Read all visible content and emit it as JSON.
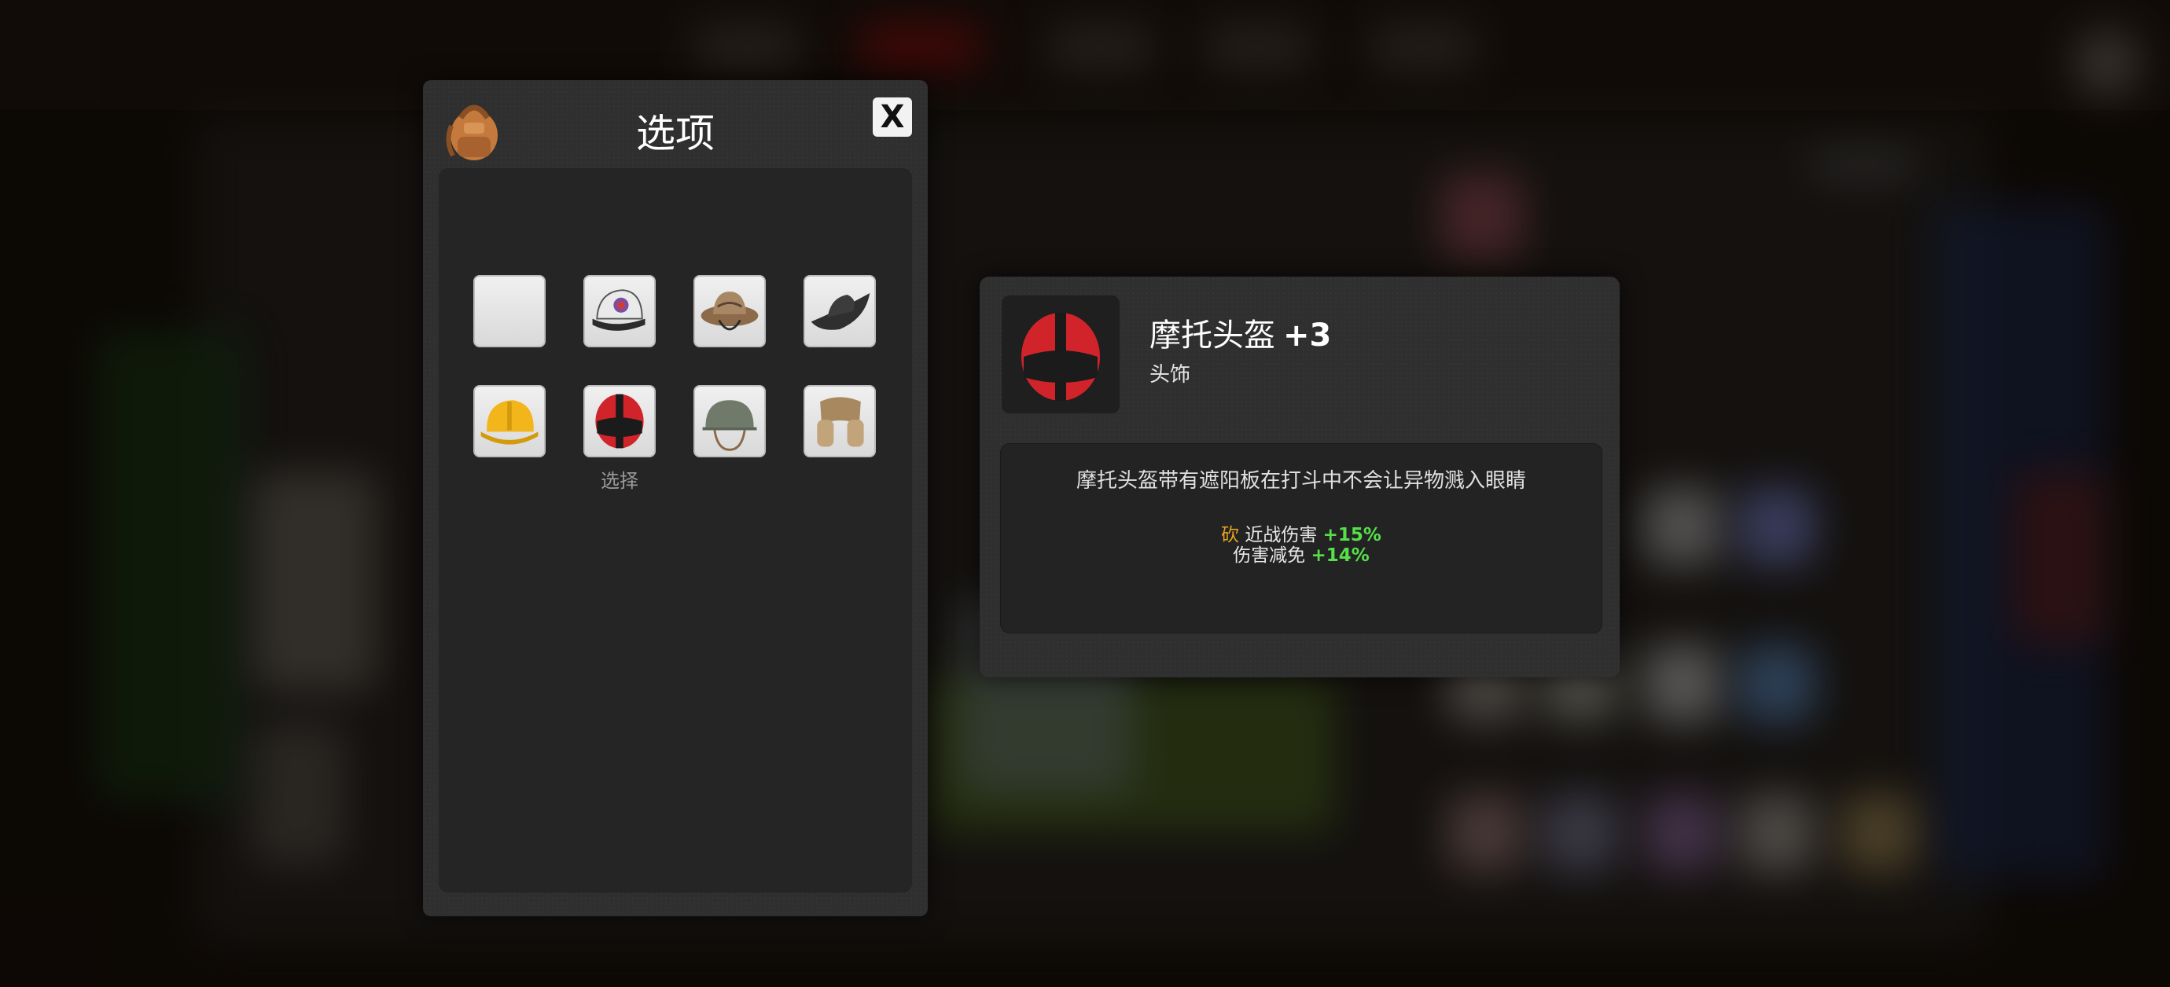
{
  "panel": {
    "title": "选项",
    "close_label": "X",
    "backpack_icon": "backpack-icon"
  },
  "slots": [
    {
      "name": "empty-slot-icon"
    },
    {
      "name": "baseball-cap-icon"
    },
    {
      "name": "boonie-hat-icon"
    },
    {
      "name": "cowboy-hat-icon"
    },
    {
      "name": "hard-hat-icon"
    },
    {
      "name": "motorcycle-helmet-icon",
      "caption": "选择"
    },
    {
      "name": "army-helmet-icon"
    },
    {
      "name": "fur-ushanka-icon"
    }
  ],
  "detail": {
    "name": "摩托头盔",
    "level": "+3",
    "type": "头饰",
    "description": "摩托头盔带有遮阳板在打斗中不会让异物溅入眼睛",
    "stats": [
      {
        "tag": "砍",
        "label": "近战伤害",
        "value": "+15%"
      },
      {
        "tag": "",
        "label": "伤害减免",
        "value": "+14%"
      }
    ]
  },
  "colors": {
    "panel_bg": "#2f2f2f",
    "stat_positive": "#55e04a",
    "tag_orange": "#e6a21f"
  }
}
